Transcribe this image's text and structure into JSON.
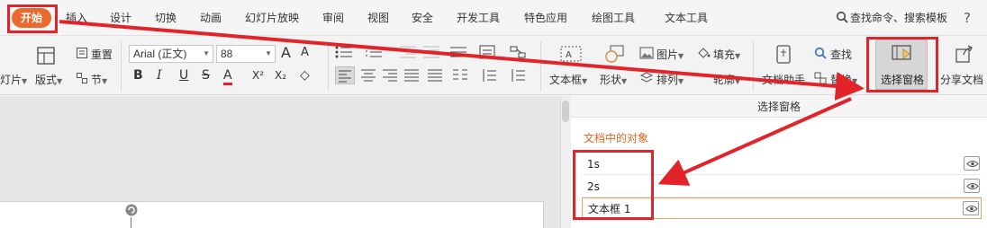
{
  "menubar": {
    "start_tab": "开始",
    "tabs": [
      "插入",
      "设计",
      "切换",
      "动画",
      "幻灯片放映",
      "审阅",
      "视图",
      "安全",
      "开发工具",
      "特色应用",
      "绘图工具",
      "文本工具"
    ],
    "search_label": "查找命令、搜索模板",
    "help_label": "?"
  },
  "ribbon": {
    "new_slide_label": "灯片",
    "layout_label": "版式",
    "reset_label": "重置",
    "section_label": "节",
    "font_name": "Arial (正文)",
    "font_size": "88",
    "grow_font": "A",
    "shrink_font": "A",
    "bold": "B",
    "italic": "I",
    "underline": "U",
    "strike": "S",
    "font_color": "A",
    "superscript": "X²",
    "subscript": "X₂",
    "clear_format": "◇",
    "textbox_label": "文本框",
    "shape_label": "形状",
    "picture_label": "图片",
    "arrange_label": "排列",
    "fill_label": "填充",
    "outline_label": "轮廓",
    "doc_assistant_label": "文档助手",
    "find_label": "查找",
    "replace_label": "替换",
    "selection_pane_label": "选择窗格",
    "share_label": "分享文档"
  },
  "selection_pane": {
    "header": "选择窗格",
    "subtitle": "文档中的对象",
    "objects": [
      "1s",
      "2s",
      "文本框 1"
    ]
  },
  "colors": {
    "accent": "#e96a2e",
    "annotation_red": "#e3232a",
    "pane_subtitle": "#d86a25"
  }
}
